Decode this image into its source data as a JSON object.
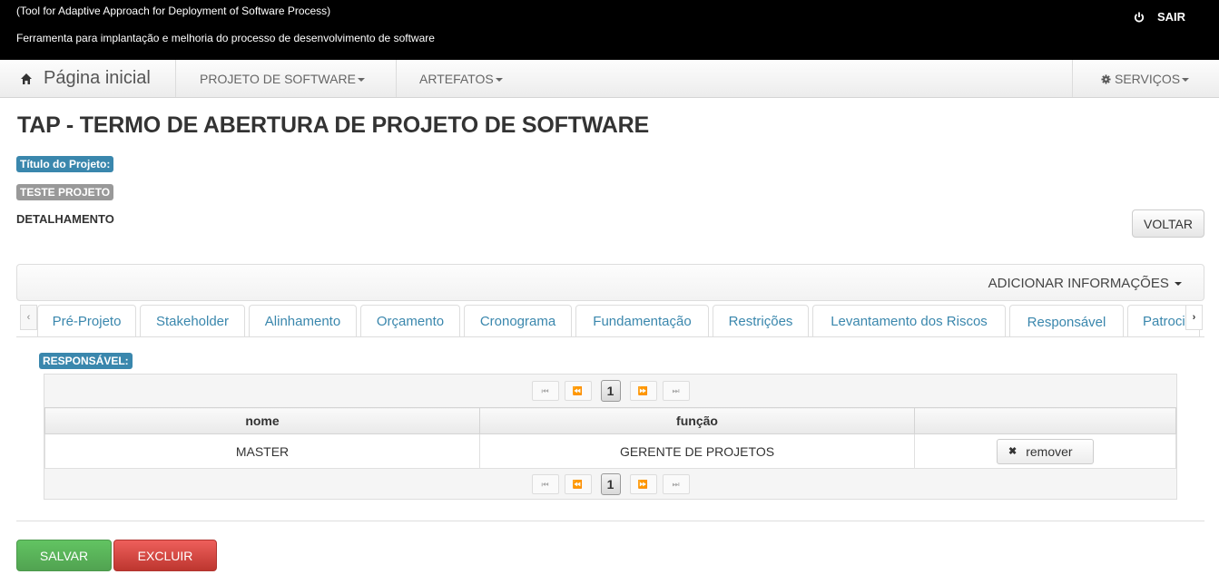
{
  "header": {
    "line1": "(Tool for Adaptive Approach for Deployment of Software Process)",
    "line2": "Ferramenta para implantação e melhoria do processo de desenvolvimento de software",
    "logout_label": "SAIR"
  },
  "nav": {
    "home_label": "Página inicial",
    "items": [
      "PROJETO DE SOFTWARE",
      "ARTEFATOS"
    ],
    "services_label": "SERVIÇOS"
  },
  "page": {
    "title": "TAP - TERMO DE ABERTURA DE PROJETO DE SOFTWARE",
    "project_title_label": "Título do Projeto:",
    "project_name": "TESTE PROJETO",
    "section_label": "DETALHAMENTO",
    "back_label": "VOLTAR",
    "add_info_label": "ADICIONAR INFORMAÇÕES"
  },
  "tabs": [
    "Pré-Projeto",
    "Stakeholder",
    "Alinhamento",
    "Orçamento",
    "Cronograma",
    "Fundamentação",
    "Restrições",
    "Levantamento dos Riscos",
    "Responsável",
    "Patroci"
  ],
  "tab_arrows": {
    "left": "‹",
    "right": "›"
  },
  "responsavel": {
    "label": "RESPONSÁVEL:",
    "pager": {
      "first": "⏮",
      "prev": "⏪",
      "page": "1",
      "next": "⏩",
      "last": "⏭"
    },
    "columns": [
      "nome",
      "função",
      ""
    ],
    "rows": [
      {
        "nome": "MASTER",
        "funcao": "GERENTE DE PROJETOS",
        "action": "remover"
      }
    ]
  },
  "footer": {
    "save_label": "SALVAR",
    "delete_label": "EXCLUIR"
  },
  "colors": {
    "accent": "#3a87ad",
    "success": "#5bb75b",
    "danger": "#da4f49"
  }
}
